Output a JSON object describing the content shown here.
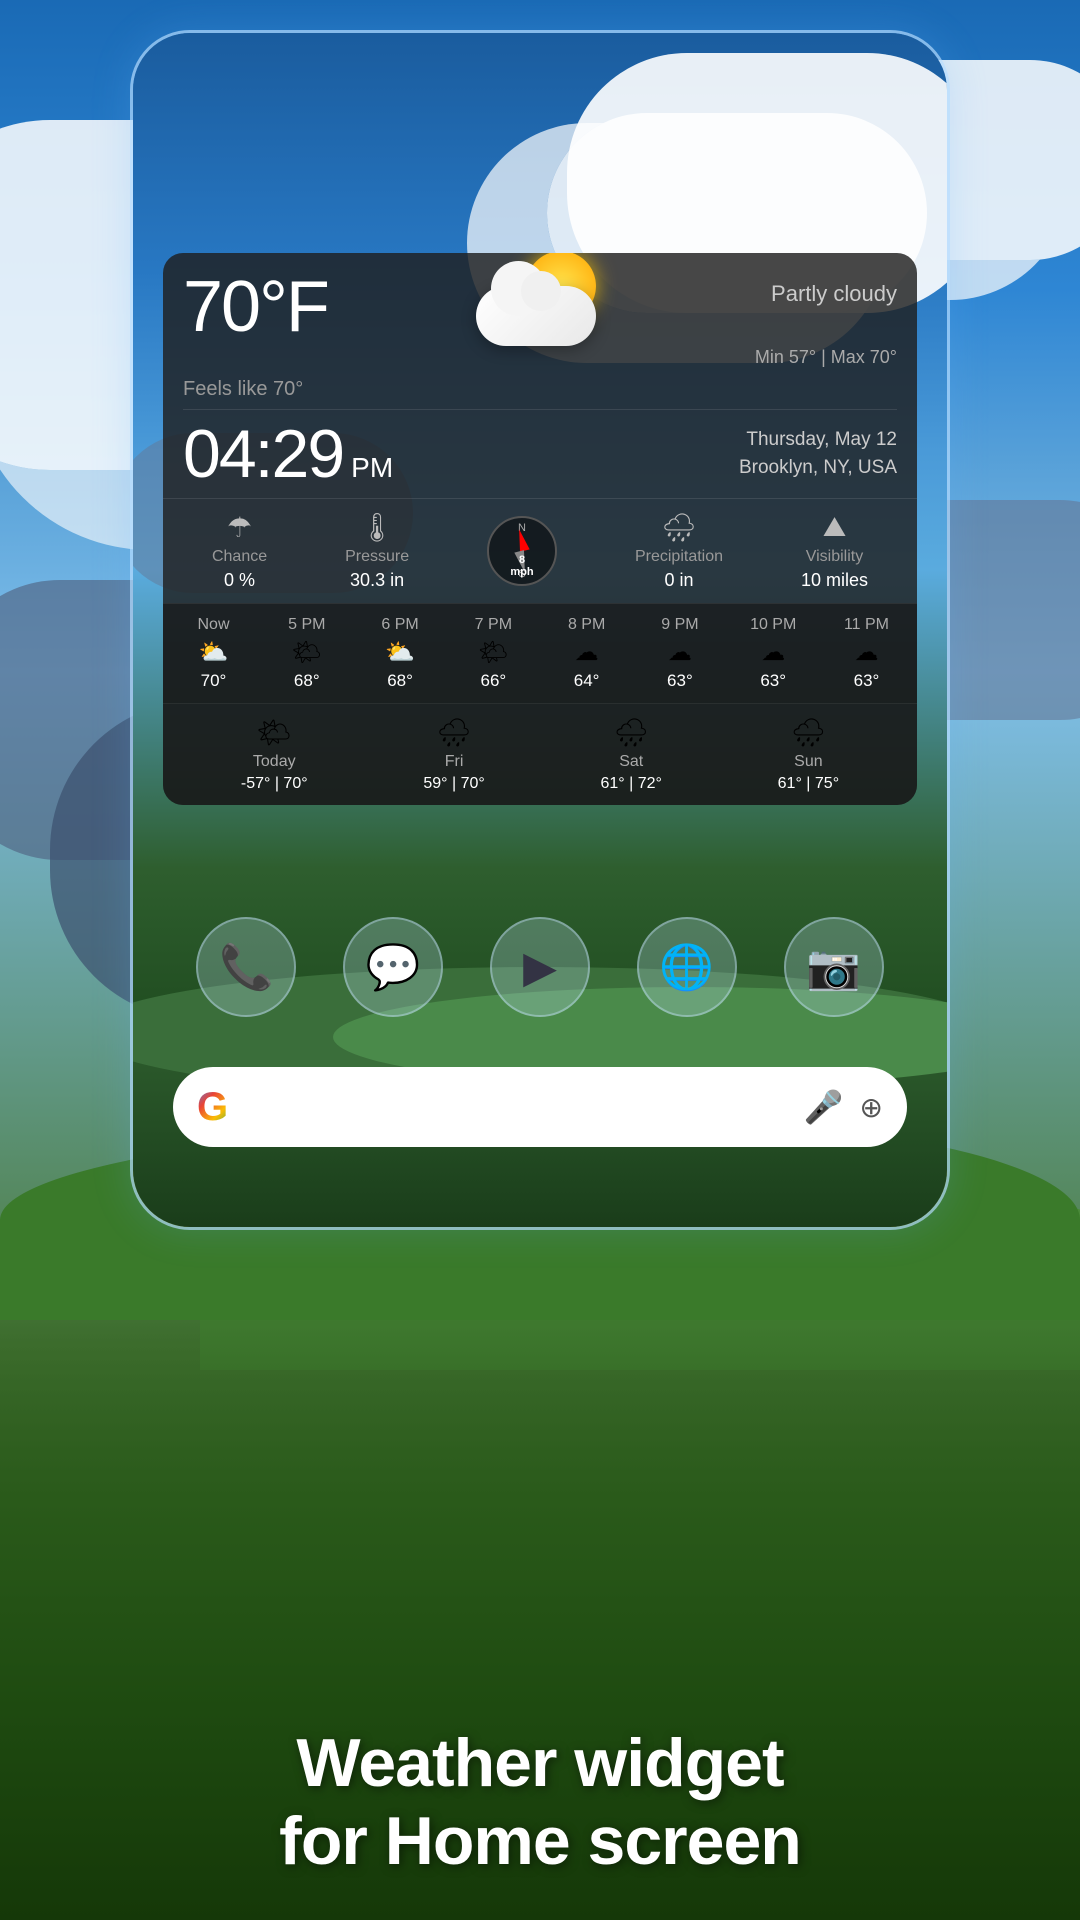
{
  "background": {
    "sky_color_top": "#1a6ab5",
    "sky_color_bottom": "#5ba3d9"
  },
  "weather_widget": {
    "temperature": "70°F",
    "condition": "Partly cloudy",
    "feels_like": "Feels like  70°",
    "min_temp": "Min 57°",
    "max_temp": "Max 70°",
    "time": "04:29",
    "ampm": "PM",
    "date": "Thursday, May 12",
    "location": "Brooklyn, NY, USA",
    "chance_label": "Chance",
    "chance_value": "0 %",
    "pressure_label": "Pressure",
    "pressure_value": "30.3 in",
    "wind_speed": "8",
    "wind_unit": "mph",
    "precipitation_label": "Precipitation",
    "precipitation_value": "0 in",
    "visibility_label": "Visibility",
    "visibility_value": "10 miles",
    "hourly": [
      {
        "time": "Now",
        "temp": "70°",
        "icon": "⛅"
      },
      {
        "time": "5 PM",
        "temp": "68°",
        "icon": "🌤"
      },
      {
        "time": "6 PM",
        "temp": "68°",
        "icon": "⛅"
      },
      {
        "time": "7 PM",
        "temp": "66°",
        "icon": "🌤"
      },
      {
        "time": "8 PM",
        "temp": "64°",
        "icon": "☁"
      },
      {
        "time": "9 PM",
        "temp": "63°",
        "icon": "☁"
      },
      {
        "time": "10 PM",
        "temp": "63°",
        "icon": "☁"
      },
      {
        "time": "11 PM",
        "temp": "63°",
        "icon": "☁"
      }
    ],
    "daily": [
      {
        "name": "Today",
        "icon": "🌤",
        "low": "-57°",
        "high": "70°"
      },
      {
        "name": "Fri",
        "icon": "🌧",
        "low": "59°",
        "high": "70°"
      },
      {
        "name": "Sat",
        "icon": "🌧",
        "low": "61°",
        "high": "72°"
      },
      {
        "name": "Sun",
        "icon": "🌧",
        "low": "61°",
        "high": "75°"
      }
    ]
  },
  "dock": {
    "apps": [
      {
        "name": "Phone",
        "icon": "📞"
      },
      {
        "name": "Messages",
        "icon": "💬"
      },
      {
        "name": "Play Store",
        "icon": "▶"
      },
      {
        "name": "Chrome",
        "icon": "🌐"
      },
      {
        "name": "Camera",
        "icon": "📷"
      }
    ]
  },
  "search_bar": {
    "google_letter": "G",
    "placeholder": ""
  },
  "caption": {
    "line1": "Weather widget",
    "line2": "for Home screen"
  }
}
